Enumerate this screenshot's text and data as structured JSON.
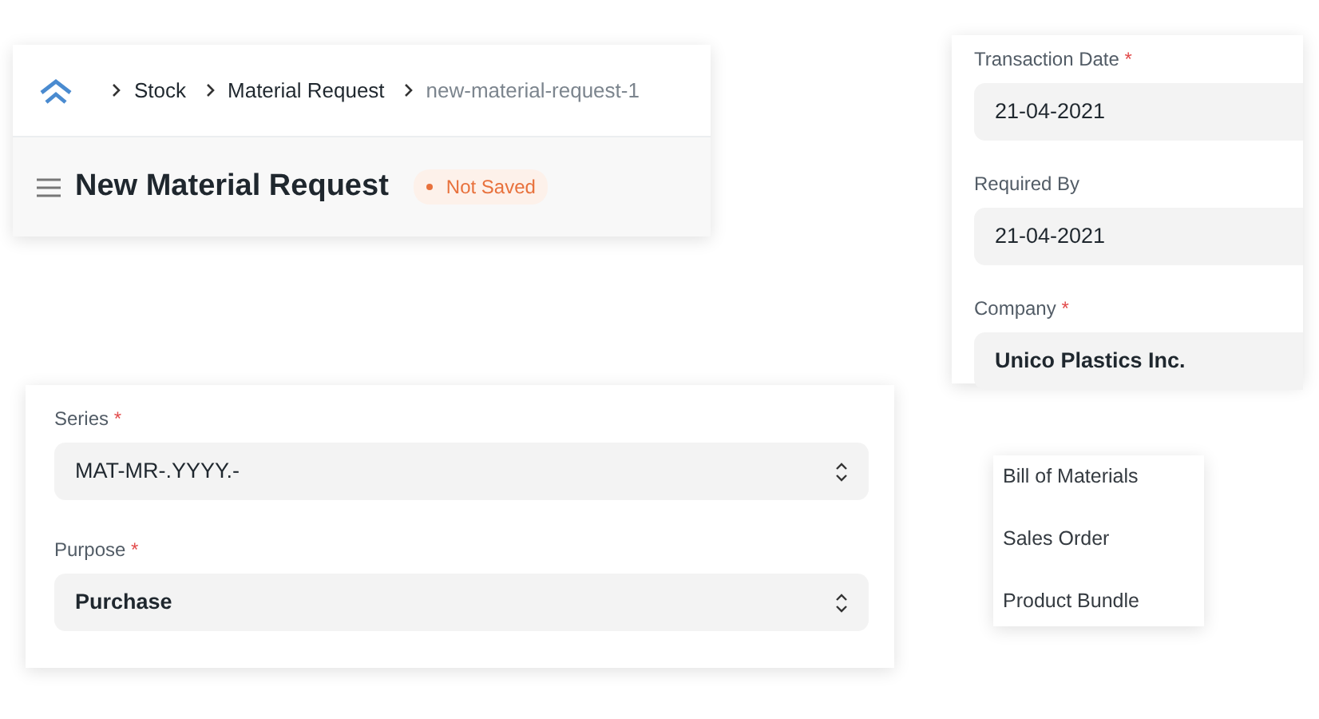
{
  "breadcrumb": {
    "items": [
      {
        "label": "Stock",
        "current": false
      },
      {
        "label": "Material Request",
        "current": false
      },
      {
        "label": "new-material-request-1",
        "current": true
      }
    ]
  },
  "page_title": "New Material Request",
  "status_indicator": {
    "label": "Not Saved"
  },
  "date_fields": [
    {
      "label": "Transaction Date",
      "required_mark": "*",
      "value": "21-04-2021",
      "bold": false
    },
    {
      "label": "Required By",
      "value": "21-04-2021",
      "bold": false
    },
    {
      "label": "Company",
      "required_mark": "*",
      "value": "Unico Plastics Inc.",
      "bold": true
    }
  ],
  "form_fields": [
    {
      "label": "Series",
      "required_mark": "*",
      "value": "MAT-MR-.YYYY.-",
      "kind": "select",
      "bold": false
    },
    {
      "label": "Purpose",
      "required_mark": "*",
      "value": "Purchase",
      "kind": "select",
      "bold": true
    }
  ],
  "menu": {
    "items": [
      {
        "label": "Bill of Materials"
      },
      {
        "label": "Sales Order"
      },
      {
        "label": "Product Bundle"
      }
    ]
  }
}
